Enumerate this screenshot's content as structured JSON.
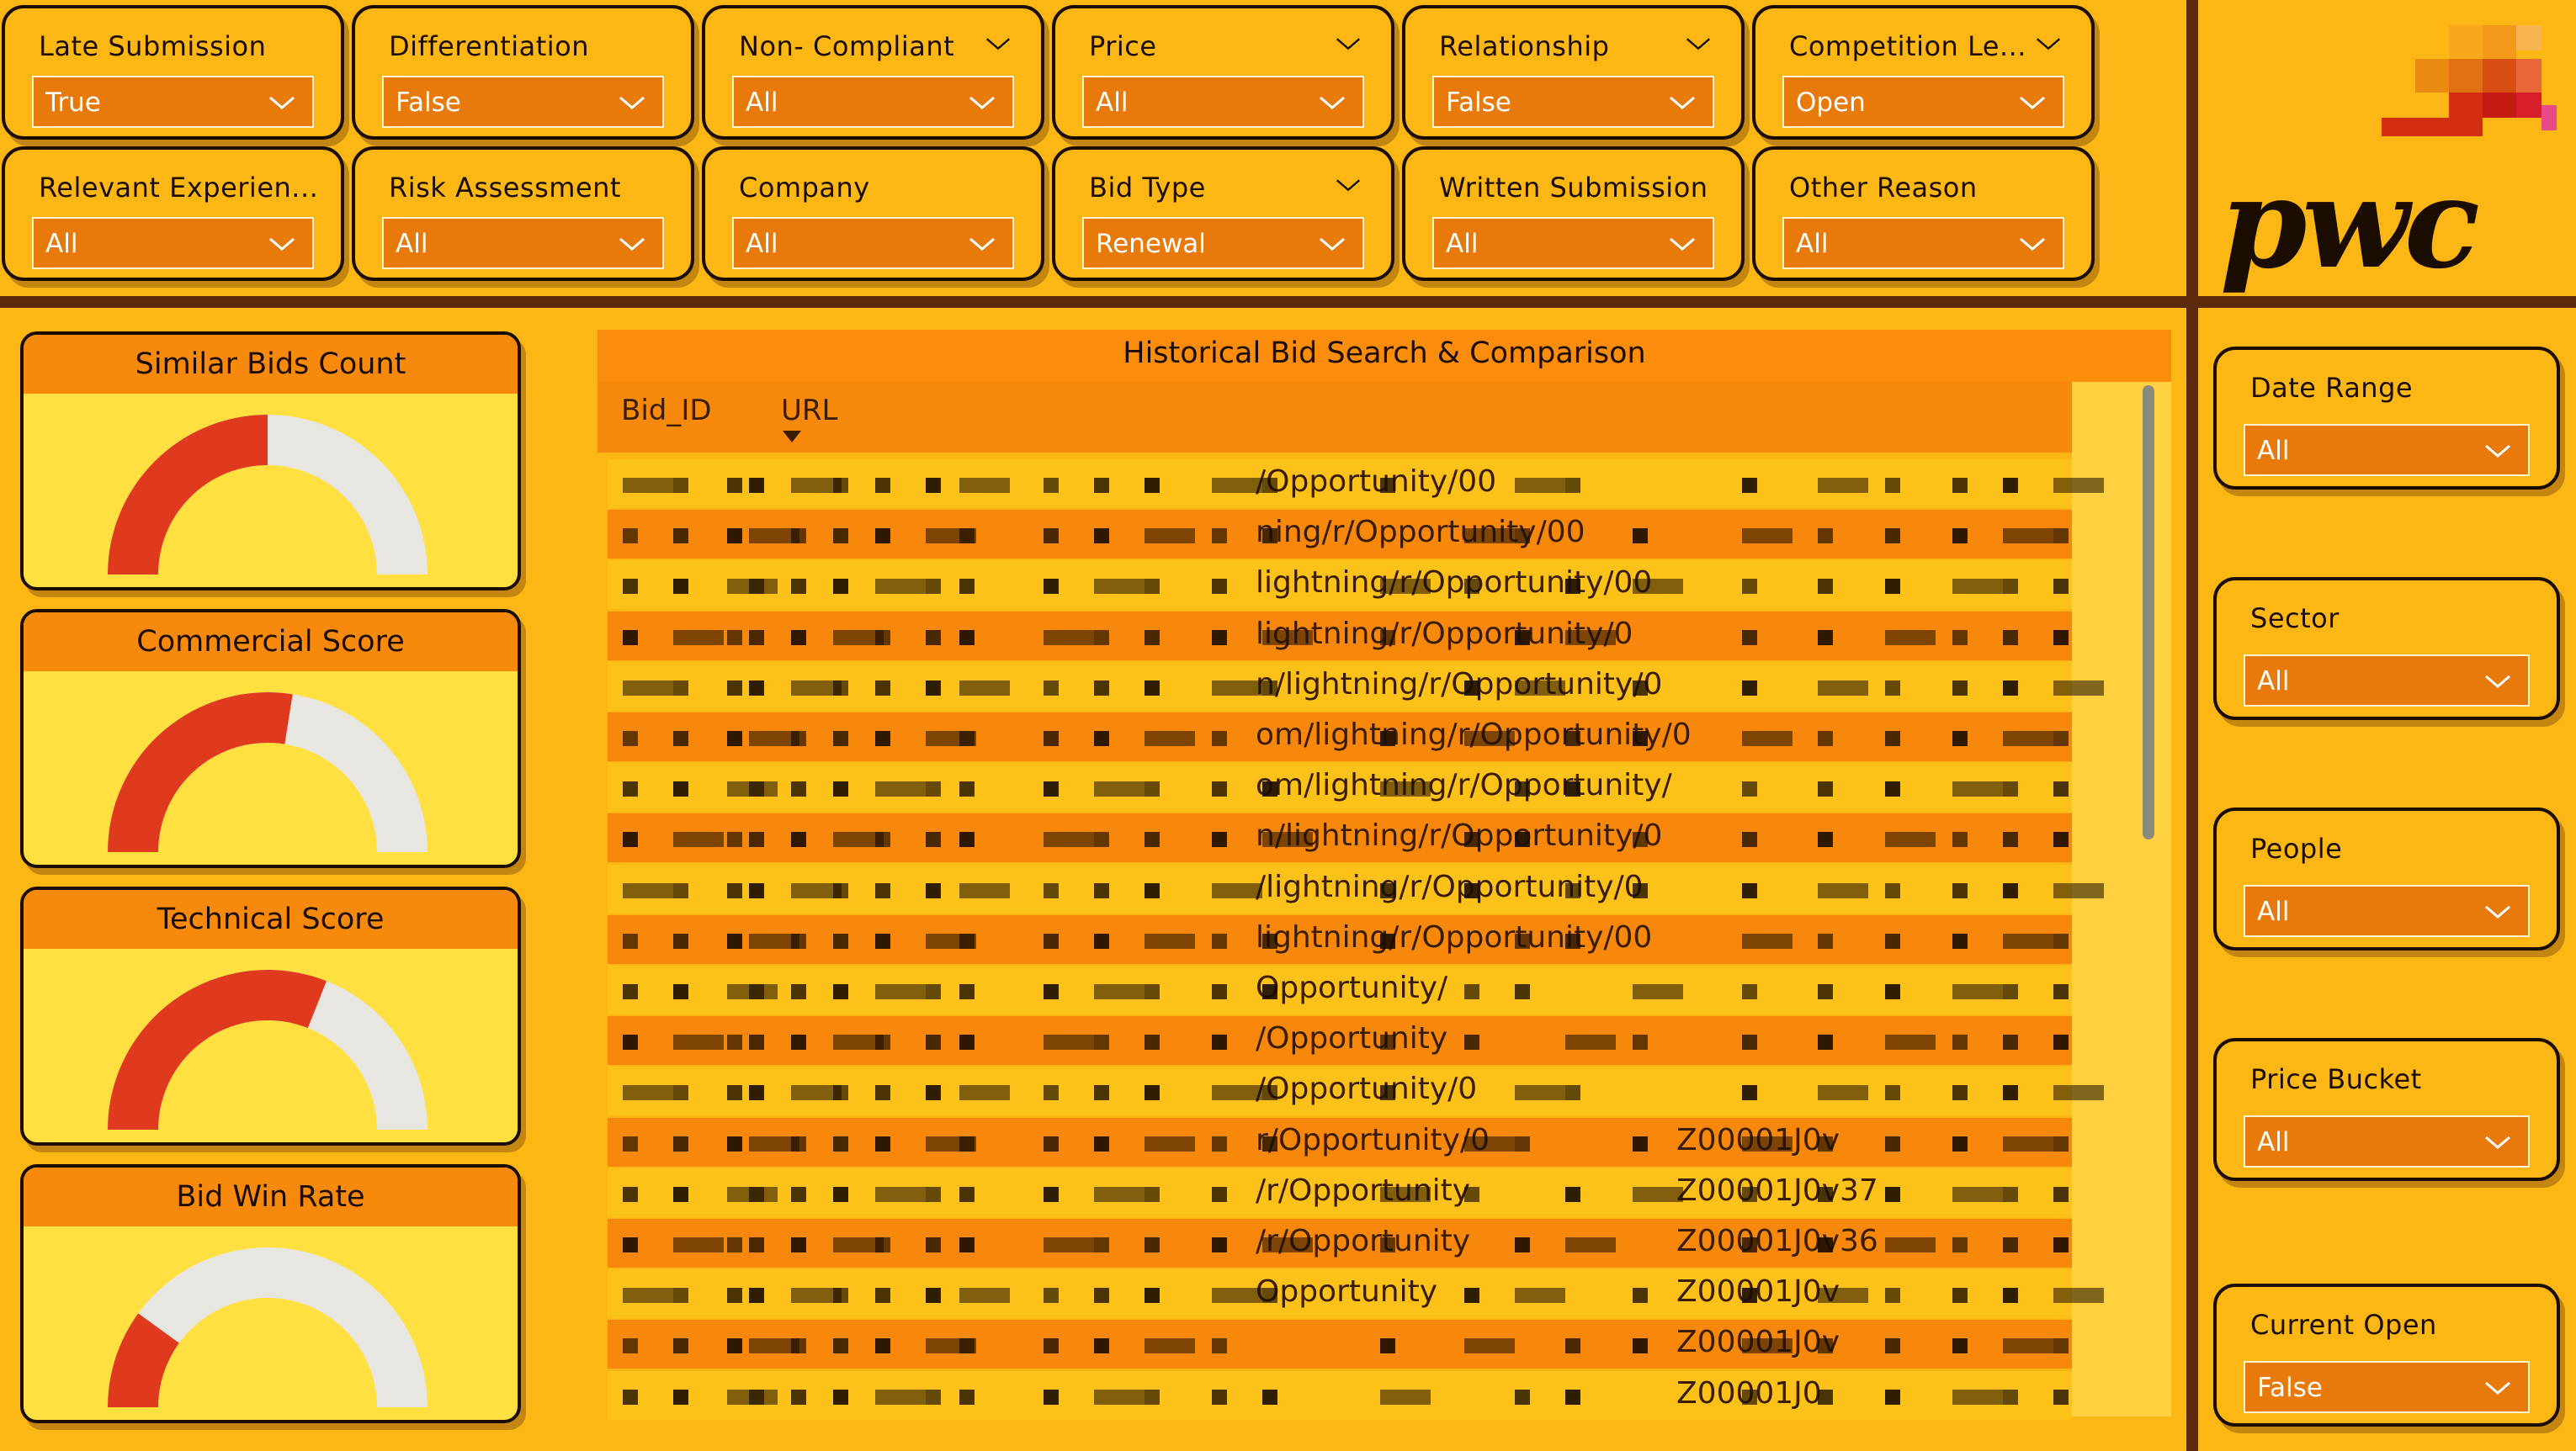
{
  "brand": {
    "logo_text": "pwc",
    "accent": "#FDB714",
    "dark": "#5A2A0A",
    "orange": "#E8790B"
  },
  "top_slicers": [
    {
      "title": "Late Submission",
      "value": "True",
      "header_chevron": false
    },
    {
      "title": "Differentiation",
      "value": "False",
      "header_chevron": false
    },
    {
      "title": "Non- Compliant",
      "value": "All",
      "header_chevron": true
    },
    {
      "title": "Price",
      "value": "All",
      "header_chevron": true
    },
    {
      "title": "Relationship",
      "value": "False",
      "header_chevron": true
    },
    {
      "title": "Competition Le...",
      "value": "Open",
      "header_chevron": true
    },
    {
      "title": "Relevant Experien...",
      "value": "All",
      "header_chevron": false
    },
    {
      "title": "Risk Assessment",
      "value": "All",
      "header_chevron": false
    },
    {
      "title": "Company",
      "value": "All",
      "header_chevron": false
    },
    {
      "title": "Bid Type",
      "value": "Renewal",
      "header_chevron": true
    },
    {
      "title": "Written Submission",
      "value": "All",
      "header_chevron": false
    },
    {
      "title": "Other Reason",
      "value": "All",
      "header_chevron": false
    }
  ],
  "right_slicers": [
    {
      "title": "Date Range",
      "value": "All"
    },
    {
      "title": "Sector",
      "value": "All"
    },
    {
      "title": "People",
      "value": "All"
    },
    {
      "title": "Price Bucket",
      "value": "All"
    },
    {
      "title": "Current Open",
      "value": "False"
    }
  ],
  "gauges": [
    {
      "title": "Similar Bids Count",
      "fill_fraction": 0.5,
      "color": "#E03A1E"
    },
    {
      "title": "Commercial Score",
      "fill_fraction": 0.55,
      "color": "#E03A1E"
    },
    {
      "title": "Technical Score",
      "fill_fraction": 0.62,
      "color": "#E03A1E"
    },
    {
      "title": "Bid Win Rate",
      "fill_fraction": 0.2,
      "color": "#E03A1E"
    }
  ],
  "table": {
    "title": "Historical Bid Search & Comparison",
    "columns": [
      "Bid_ID",
      "URL"
    ],
    "sort_column": "URL",
    "rows": [
      {
        "url": "/Opportunity/00",
        "extra": ""
      },
      {
        "url": "ning/r/Opportunity/00",
        "extra": ""
      },
      {
        "url": "lightning/r/Opportunity/00",
        "extra": ""
      },
      {
        "url": "lightning/r/Opportunity/0",
        "extra": ""
      },
      {
        "url": "n/lightning/r/Opportunity/0",
        "extra": ""
      },
      {
        "url": "om/lightning/r/Opportunity/0",
        "extra": ""
      },
      {
        "url": "om/lightning/r/Opportunity/",
        "extra": ""
      },
      {
        "url": "n/lightning/r/Opportunity/0",
        "extra": ""
      },
      {
        "url": "/lightning/r/Opportunity/0",
        "extra": ""
      },
      {
        "url": "lightning/r/Opportunity/00",
        "extra": ""
      },
      {
        "url": "Opportunity/",
        "extra": ""
      },
      {
        "url": "/Opportunity",
        "extra": ""
      },
      {
        "url": "/Opportunity/0",
        "extra": ""
      },
      {
        "url": "r/Opportunity/0",
        "extra": "Z00001J0v"
      },
      {
        "url": "/r/Opportunity",
        "extra": "Z00001J0v37"
      },
      {
        "url": "/r/Opportunity",
        "extra": "Z00001J0v36"
      },
      {
        "url": "Opportunity",
        "extra": "Z00001J0v"
      },
      {
        "url": "",
        "extra": "Z00001J0v"
      },
      {
        "url": "",
        "extra": "Z00001J0"
      }
    ]
  }
}
